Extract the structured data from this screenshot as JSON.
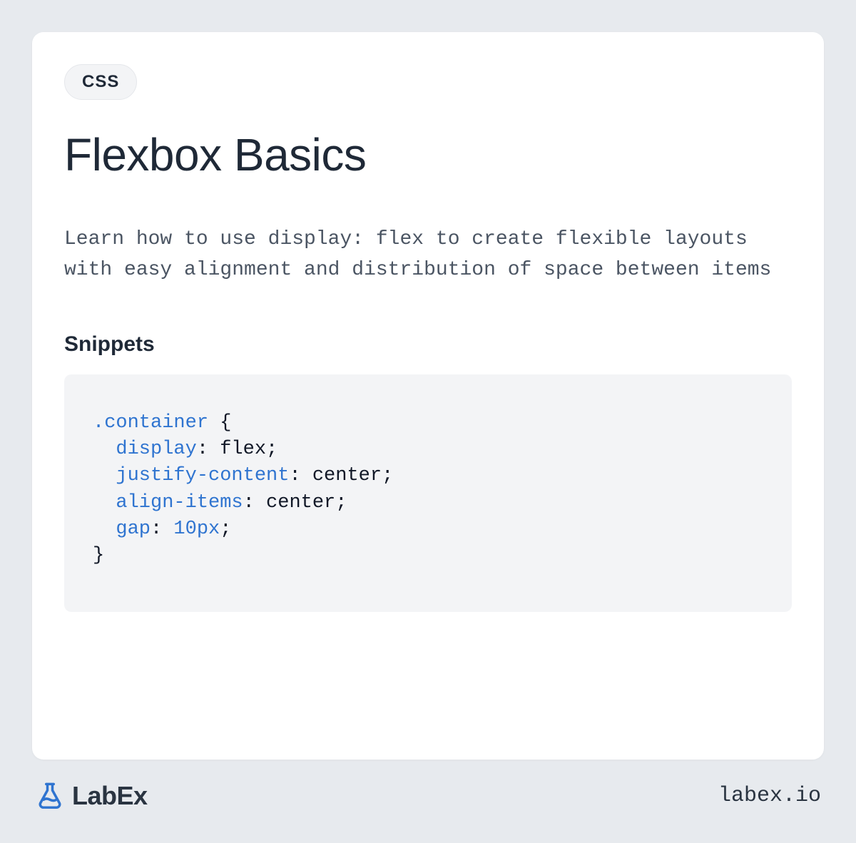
{
  "badge": "CSS",
  "title": "Flexbox Basics",
  "description": "Learn how to use display: flex to create flexible layouts with easy alignment and distribution of space between items",
  "section_heading": "Snippets",
  "snippet": {
    "selector": ".container",
    "brace_open": " {",
    "lines": [
      {
        "prop": "display",
        "sep": ": ",
        "value": "flex",
        "end": ";"
      },
      {
        "prop": "justify-content",
        "sep": ": ",
        "value": "center",
        "end": ";"
      },
      {
        "prop": "align-items",
        "sep": ": ",
        "value": "center",
        "end": ";"
      },
      {
        "prop": "gap",
        "sep": ": ",
        "value": "10px",
        "end": ";",
        "value_is_number": true
      }
    ],
    "brace_close": "}"
  },
  "brand": "LabEx",
  "site_url": "labex.io"
}
